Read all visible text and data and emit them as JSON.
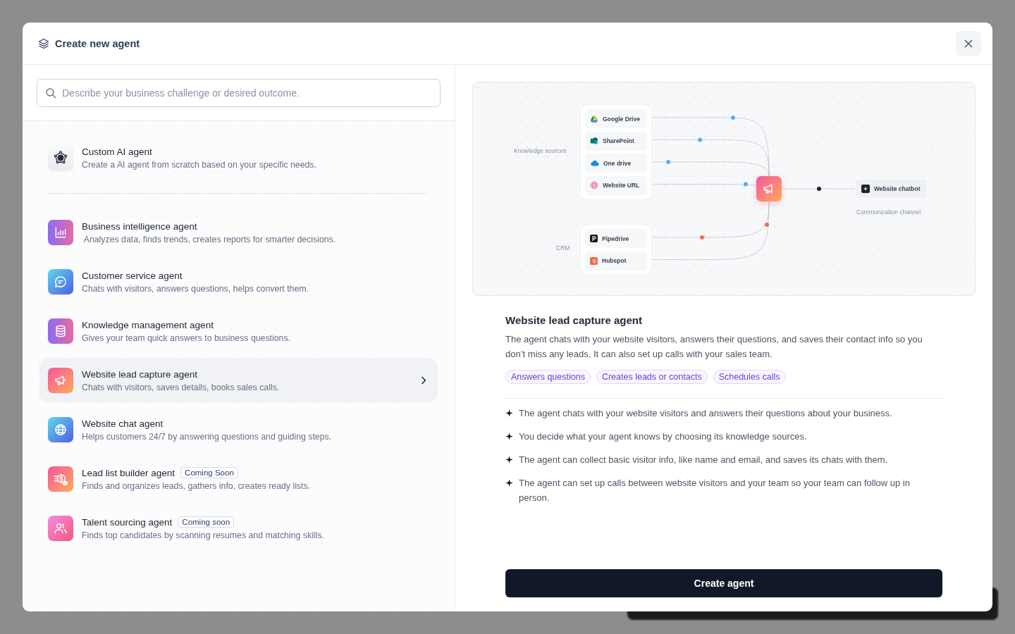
{
  "dialog": {
    "title": "Create new agent"
  },
  "search": {
    "placeholder": "Describe your business challenge or desired outcome."
  },
  "custom_agent": {
    "name": "Custom AI agent",
    "description": "Create a AI agent from scratch based on your specific needs.",
    "kind": "ai",
    "selected": false
  },
  "agents": [
    {
      "name": "Business intelligence agent",
      "description": " Analyzes data, finds trends, creates reports for smarter decisions.",
      "kind": "chart",
      "selected": false
    },
    {
      "name": "Customer service agent",
      "description": "Chats with visitors, answers questions, helps convert them.",
      "kind": "chat",
      "selected": false
    },
    {
      "name": "Knowledge management agent",
      "description": "Gives your team quick answers to business questions.",
      "kind": "database",
      "selected": false
    },
    {
      "name": "Website lead capture agent",
      "description": "Chats with visitors, saves details, books sales calls.",
      "kind": "megaphone",
      "selected": true
    },
    {
      "name": "Website chat agent",
      "description": "Helps customers 24/7 by answering questions and guiding steps.",
      "kind": "globe",
      "selected": false
    },
    {
      "name": "Lead list builder agent",
      "badge": "Coming Soon",
      "description": "Finds and organizes leads, gathers info, creates ready lists.",
      "kind": "coins",
      "selected": false
    },
    {
      "name": "Talent sourcing agent",
      "badge": "Coming soon",
      "description": "Finds top candidates by scanning resumes and matching skills.",
      "kind": "people",
      "selected": false
    }
  ],
  "diagram": {
    "source_groups": [
      {
        "label": "Knowledge sources",
        "color": "#5aaee8",
        "items": [
          {
            "label": "Google Drive",
            "kind": "drive"
          },
          {
            "label": "SharePoint",
            "kind": "sharepoint"
          },
          {
            "label": "One drive",
            "kind": "cloud"
          },
          {
            "label": "Website URL",
            "kind": "globe"
          }
        ]
      },
      {
        "label": "CRM",
        "color": "#ef6a53",
        "items": [
          {
            "label": "Pipedrive",
            "kind": "pipedrive"
          },
          {
            "label": "Hubspot",
            "kind": "hubspot"
          }
        ]
      }
    ],
    "channel": {
      "label": "Website chatbot",
      "caption": "Communication channel"
    }
  },
  "detail": {
    "title": "Website lead capture agent",
    "description": "The agent chats with your website visitors, answers their questions, and saves their contact info so you don’t miss any leads. It can also set up calls with your sales team.",
    "tags": [
      "Answers questions",
      "Creates leads or contacts",
      "Schedules calls"
    ],
    "features": [
      "The agent chats with your website visitors and answers their questions about your business.",
      "You decide what your agent knows by choosing its knowledge sources.",
      "The agent can collect basic visitor info, like name and email, and saves its chats with them.",
      "The agent can set up calls between website visitors and your team so your team can follow up in person."
    ],
    "button": "Create agent"
  }
}
